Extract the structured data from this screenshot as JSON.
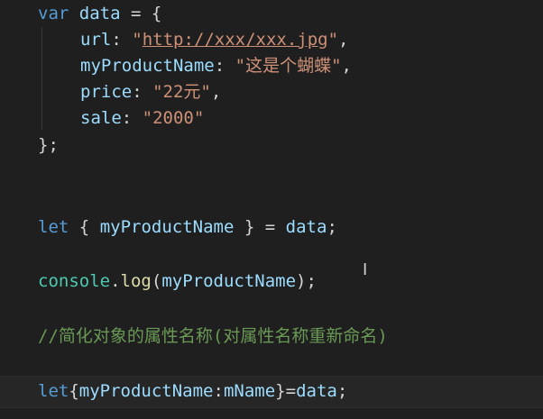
{
  "code": {
    "line1": {
      "kw": "var",
      "name": "data",
      "op": "=",
      "brace": "{"
    },
    "line2": {
      "key": "url",
      "colon": ":",
      "q1": "\"",
      "url": "http://xxx/xxx.jpg",
      "q2": "\"",
      "comma": ","
    },
    "line3": {
      "key": "myProductName",
      "colon": ":",
      "value": "\"这是个蝴蝶\"",
      "comma": ","
    },
    "line4": {
      "key": "price",
      "colon": ":",
      "value": "\"22元\"",
      "comma": ","
    },
    "line5": {
      "key": "sale",
      "colon": ":",
      "value": "\"2000\""
    },
    "line6": {
      "close": "};"
    },
    "line7": {
      "kw": "let",
      "open": "{",
      "name": "myProductName",
      "close": "}",
      "op": "=",
      "source": "data",
      "semi": ";"
    },
    "line8": {
      "obj": "console",
      "dot": ".",
      "fn": "log",
      "lp": "(",
      "arg": "myProductName",
      "rp": ")",
      "semi": ";"
    },
    "line9": {
      "comment": "//简化对象的属性名称(对属性名称重新命名)"
    },
    "line10": {
      "kw": "let",
      "open": "{",
      "name": "myProductName",
      "colon": ":",
      "alias": "mName",
      "close": "}",
      "op": "=",
      "source": "data",
      "semi": ";"
    }
  },
  "cursor": {
    "glyph": "I"
  },
  "colors": {
    "background": "#1f1f1f",
    "keyword": "#569cd6",
    "variable": "#9cdcfe",
    "string": "#ce9178",
    "function": "#dcdcaa",
    "comment": "#6a9955"
  }
}
